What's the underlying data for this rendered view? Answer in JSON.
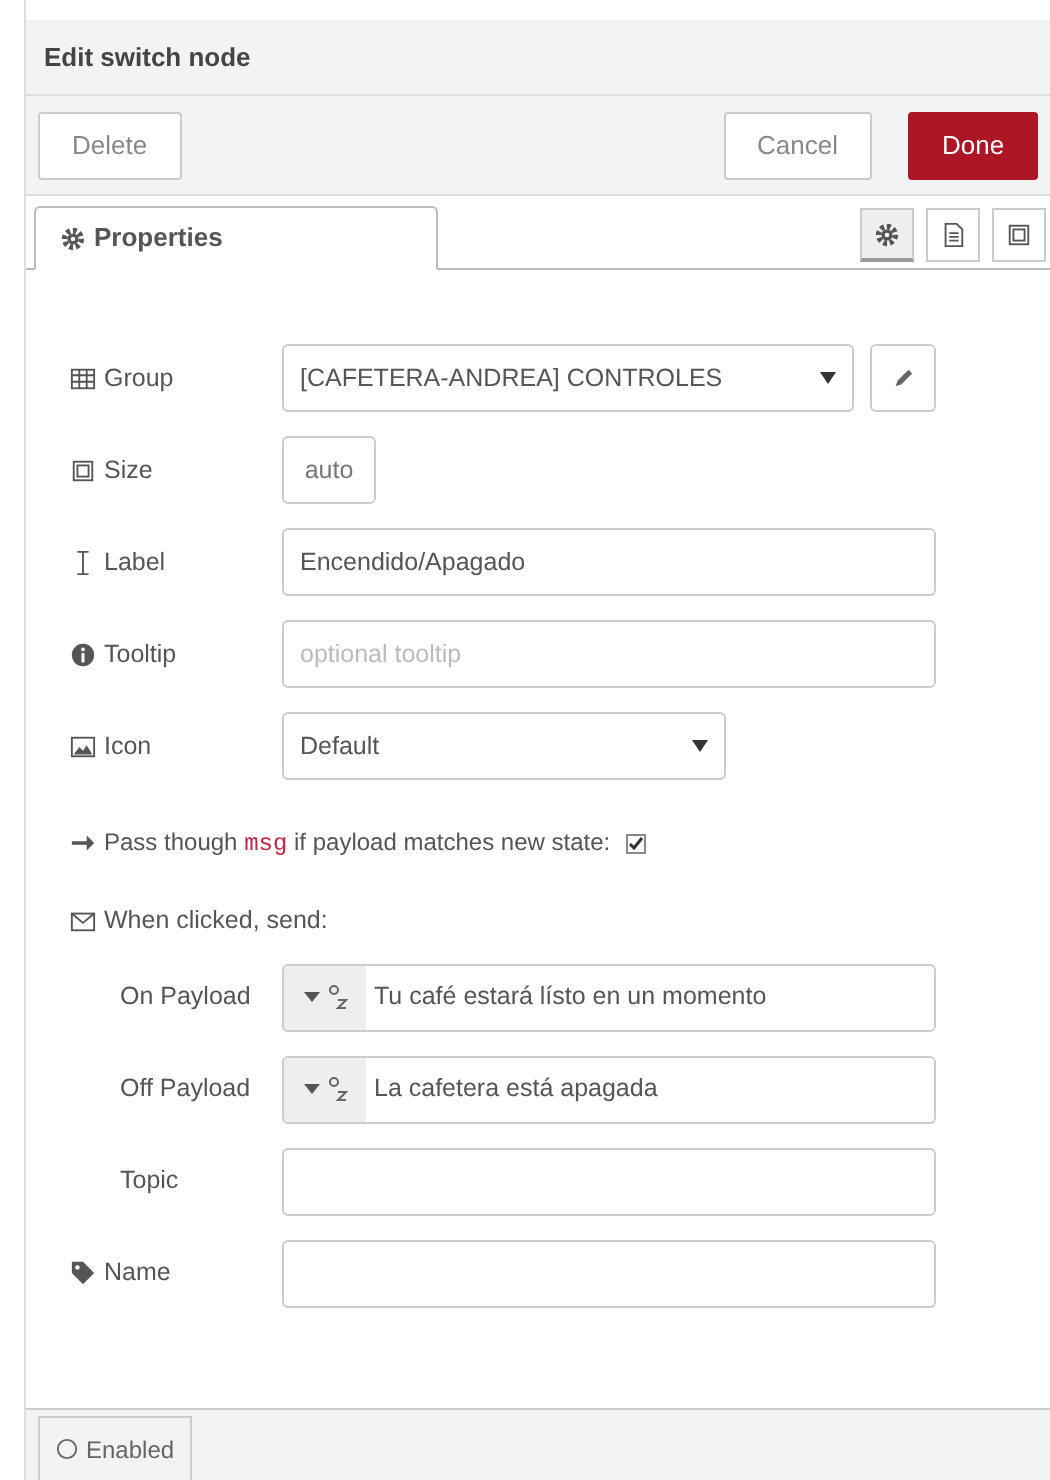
{
  "window": {
    "title": "Edit switch node"
  },
  "buttons": {
    "left": [
      {
        "label": "Delete",
        "kind": "plain"
      }
    ],
    "right": [
      {
        "label": "Cancel",
        "kind": "plain"
      },
      {
        "label": "Done",
        "kind": "primary"
      }
    ]
  },
  "tabs": [
    {
      "label": "Properties",
      "selected": true
    }
  ],
  "tab_icons": [
    {
      "kind": "gear",
      "selected": true
    },
    {
      "kind": "doc",
      "selected": false
    },
    {
      "kind": "frame",
      "selected": false
    }
  ],
  "fields": [
    {
      "kind": "select",
      "label": "Group",
      "value": "[CAFETERA-ANDREA] CONTROLES",
      "edit": true
    },
    {
      "kind": "size",
      "label": "Size",
      "value": "auto"
    },
    {
      "kind": "text",
      "label": "Label",
      "value": "Encendido/Apagado"
    },
    {
      "kind": "text",
      "label": "Tooltip",
      "placeholder": "optional tooltip"
    },
    {
      "kind": "select",
      "label": "Icon",
      "value": "Default",
      "edit": false
    }
  ],
  "pass_through": {
    "before": "Pass though",
    "code": "msg",
    "after": "if payload matches new state:",
    "checked": true
  },
  "send": {
    "heading": "When clicked, send:",
    "rows": [
      {
        "kind": "typed",
        "label": "On Payload",
        "value": "Tu café estará lísto en un momento"
      },
      {
        "kind": "typed",
        "label": "Off Payload",
        "value": "La cafetera está apagada"
      },
      {
        "kind": "text",
        "label": "Topic"
      }
    ]
  },
  "name": {
    "label": "Name"
  },
  "footer": {
    "label": "Enabled"
  }
}
